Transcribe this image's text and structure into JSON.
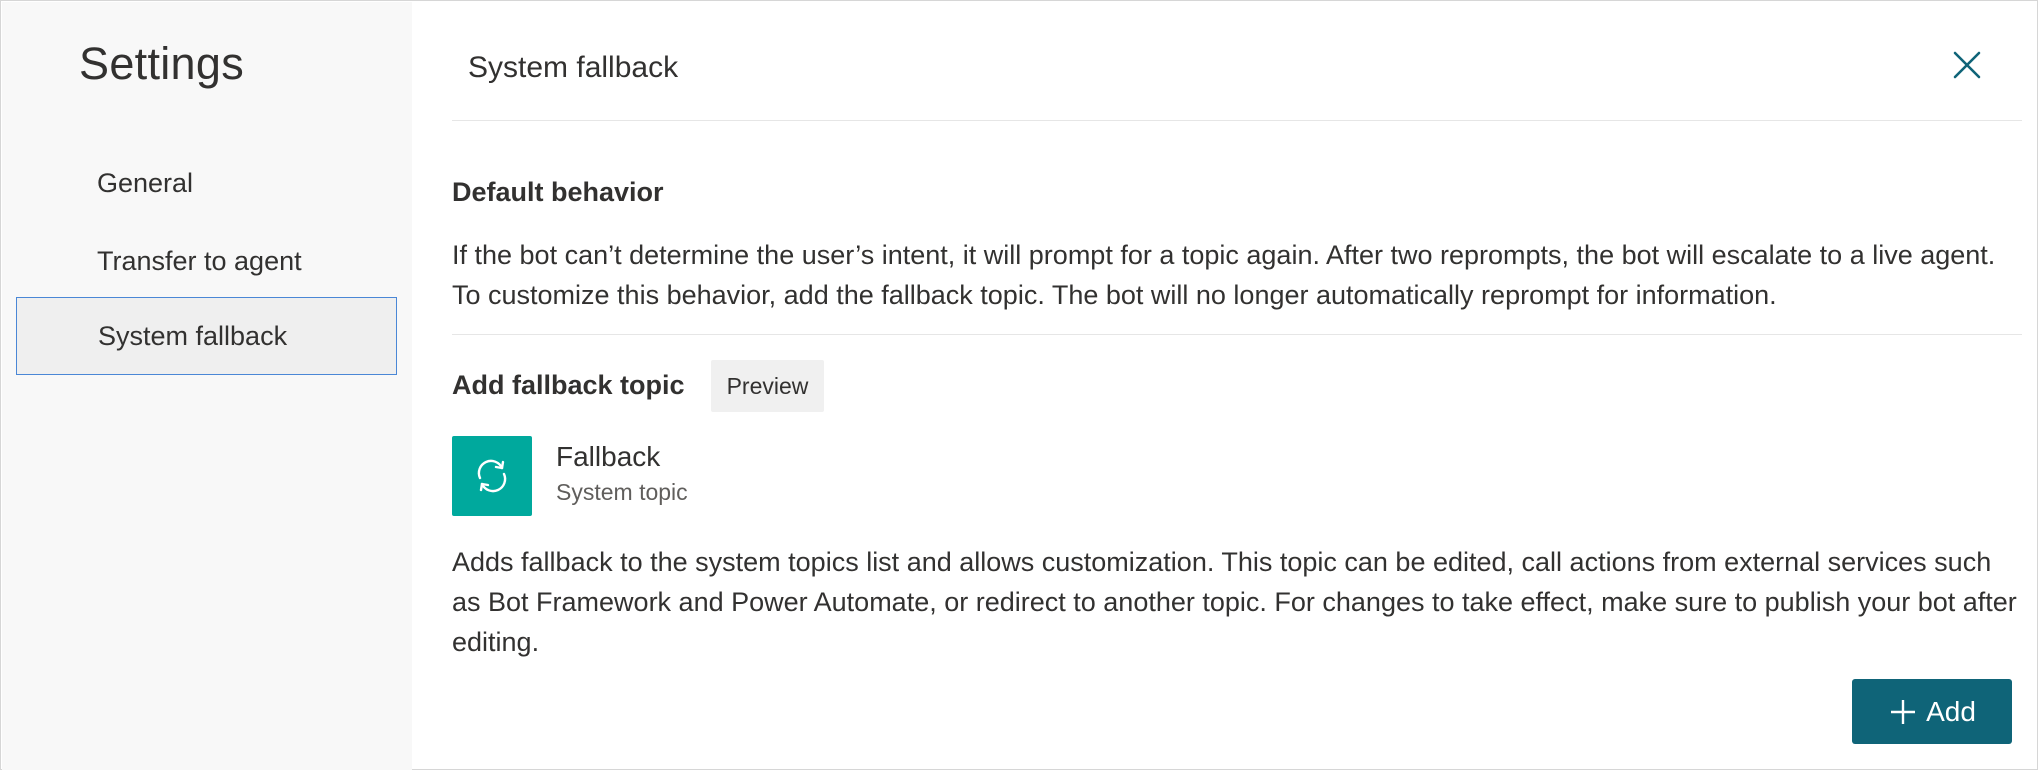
{
  "sidebar": {
    "title": "Settings",
    "items": [
      {
        "label": "General"
      },
      {
        "label": "Transfer to agent"
      },
      {
        "label": "System fallback"
      }
    ]
  },
  "panel": {
    "title": "System fallback",
    "close_icon": "close-icon",
    "default_behavior": {
      "heading": "Default behavior",
      "text": "If the bot can’t determine the user’s intent, it will prompt for a topic again. After two reprompts, the bot will escalate to a live agent. To customize this behavior, add the fallback topic. The bot will no longer automatically reprompt for information."
    },
    "add_fallback": {
      "heading": "Add fallback topic",
      "badge": "Preview",
      "topic": {
        "icon": "refresh-icon",
        "name": "Fallback",
        "subtitle": "System topic"
      },
      "text": "Adds fallback to the system topics list and allows customization. This topic can be edited, call actions from external services such as Bot Framework and Power Automate, or redirect to another topic. For changes to take effect, make sure to publish your bot after editing.",
      "button_label": "Add"
    }
  },
  "colors": {
    "accent": "#0f6478",
    "topic_icon_bg": "#00a99d",
    "selection_border": "#4a87d6",
    "sidebar_bg": "#f8f8f8"
  }
}
